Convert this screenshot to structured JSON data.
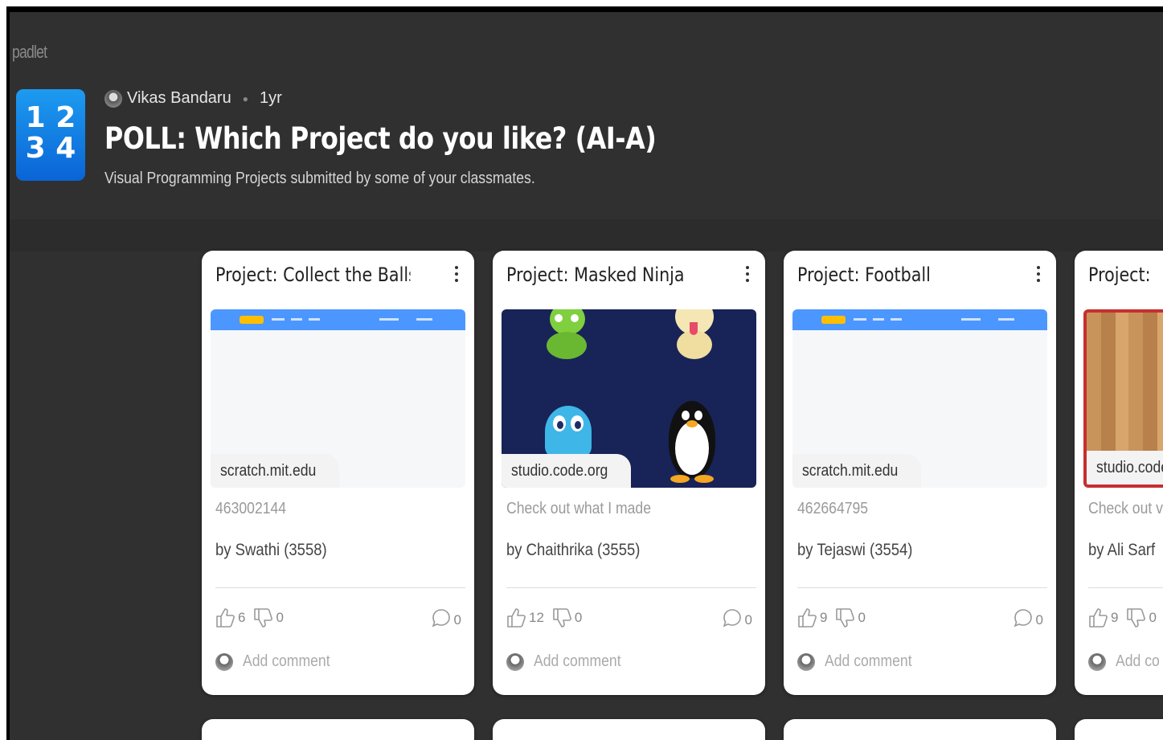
{
  "brand": "padlet",
  "app_icon": {
    "line1": "1 2",
    "line2": "3 4",
    "color": "#1d9bf0"
  },
  "header": {
    "author": "Vikas Bandaru",
    "age": "1yr",
    "title": "POLL: Which Project do you like? (AI-A)",
    "subtitle": "Visual Programming Projects submitted by some of your classmates."
  },
  "cards": [
    {
      "title": "Project: Collect the Balls",
      "domain": "scratch.mit.edu",
      "description": "463002144",
      "author": "by Swathi (3558)",
      "likes": "6",
      "dislikes": "0",
      "comments": "0",
      "add_comment": "Add comment",
      "preview": "scratch"
    },
    {
      "title": "Project: Masked Ninja",
      "domain": "studio.code.org",
      "description": "Check out what I made",
      "author": "by Chaithrika (3555)",
      "likes": "12",
      "dislikes": "0",
      "comments": "0",
      "add_comment": "Add comment",
      "preview": "characters"
    },
    {
      "title": "Project: Football",
      "domain": "scratch.mit.edu",
      "description": "462664795",
      "author": "by Tejaswi (3554)",
      "likes": "9",
      "dislikes": "0",
      "comments": "0",
      "add_comment": "Add comment",
      "preview": "scratch"
    },
    {
      "title": "Project:",
      "domain": "studio.code",
      "description": "Check out v",
      "author": "by Ali Sarf",
      "likes": "9",
      "dislikes": "0",
      "add_comment": "Add co",
      "preview": "wood"
    }
  ]
}
